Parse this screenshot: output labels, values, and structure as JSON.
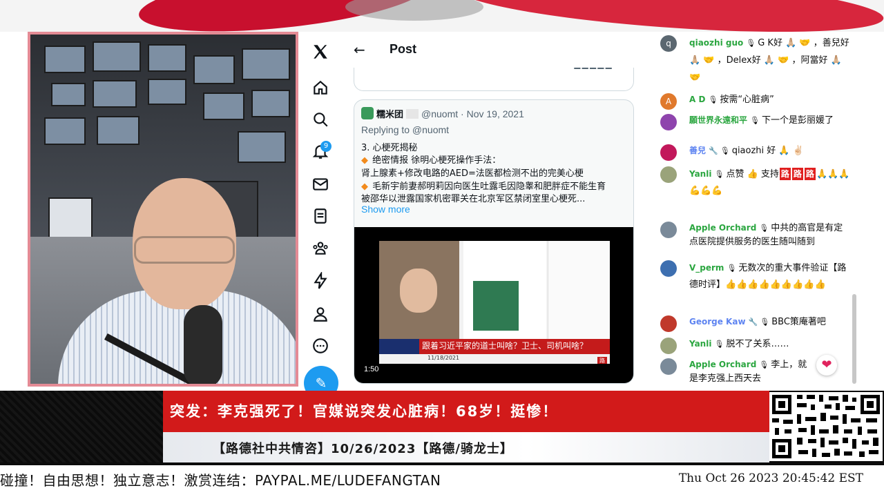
{
  "x_app": {
    "nav": {
      "notification_count": "9"
    },
    "post_header": {
      "title": "Post"
    },
    "quoted_post": {
      "author_name": "糯米团",
      "handle_date": "@nuomt · Nov 19, 2021",
      "replying_to": "Replying to @nuomt",
      "lines": [
        "3. 心梗死揭秘",
        "绝密情报 徐明心梗死操作手法：",
        "肾上腺素+修改电路的AED=法医都检测不出的完美心梗",
        "毛新宇前妻郝明莉因向医生吐露毛因隐睾和肥胖症不能生育",
        "被邵华以泄露国家机密罪关在北京军区禁闭室里心梗死..."
      ],
      "show_more": "Show more",
      "video": {
        "duration": "1:50",
        "banner_text": "跟着习近平家的道士叫啥？卫士、司机叫啥？",
        "date_text": "11/18/2021",
        "corner_tag": "路"
      }
    }
  },
  "chat": {
    "messages": [
      {
        "author": "qiaozhi guo",
        "text": "G K好 🙏🏼 🤝 ，善兒好 🙏🏼 🤝 ，Delex好 🙏🏼 🤝 ，阿當好 🙏🏼 🤝",
        "avatar_color": "#5b6770",
        "avatar_letter": "q"
      },
      {
        "author": "A D",
        "text": "按需“心脏病”",
        "avatar_color": "#e0792c",
        "avatar_letter": "A"
      },
      {
        "author": "願世界永遠和平",
        "text": "下一个是彭丽媛了",
        "avatar_color": "#8e44ad",
        "avatar_letter": ""
      },
      {
        "author": "善兒",
        "text": "qiaozhi 好 🙏 ✌🏻",
        "avatar_color": "#c2185b",
        "avatar_letter": ""
      },
      {
        "author": "Yanli",
        "text_before": "点赞 👍 支持",
        "tags": [
          "路",
          "路",
          "路"
        ],
        "text_after": "🙏🙏🙏💪💪💪",
        "avatar_color": "#9aa37a",
        "avatar_letter": ""
      },
      {
        "author": "Apple Orchard",
        "text": "中共的高官是有定点医院提供服务的医生随叫随到",
        "avatar_color": "#7a8a99",
        "avatar_letter": ""
      },
      {
        "author": "V_perm",
        "text": "无数次的重大事件验证【路德时评】👍👍👍👍👍👍👍👍👍",
        "avatar_color": "#3d6fb0",
        "avatar_letter": ""
      },
      {
        "author": "George Kaw",
        "text": "BBC策庵著吧",
        "avatar_color": "#c0392b",
        "avatar_letter": ""
      },
      {
        "author": "Yanli",
        "text": "脱不了关系……",
        "avatar_color": "#9aa37a",
        "avatar_letter": ""
      },
      {
        "author": "Apple Orchard",
        "text": "李上，就是李克强上西天去",
        "avatar_color": "#7a8a99",
        "avatar_letter": ""
      }
    ]
  },
  "lower_third": {
    "headline": "突发：李克强死了！官媒说突发心脏病！68岁！挺惨！",
    "subline": "【路德社中共情咨】10/26/2023【路德/骑龙士】"
  },
  "ticker": {
    "text": "碰撞！自由思想！独立意志！激赏连结：PAYPAL.ME/LUDEFANGTAN",
    "clock": "Thu Oct 26 2023 20:45:42 EST"
  },
  "colors": {
    "x_blue": "#1d9bf0",
    "headline_red": "#d21a1a",
    "chat_author_green": "#2ba640"
  }
}
